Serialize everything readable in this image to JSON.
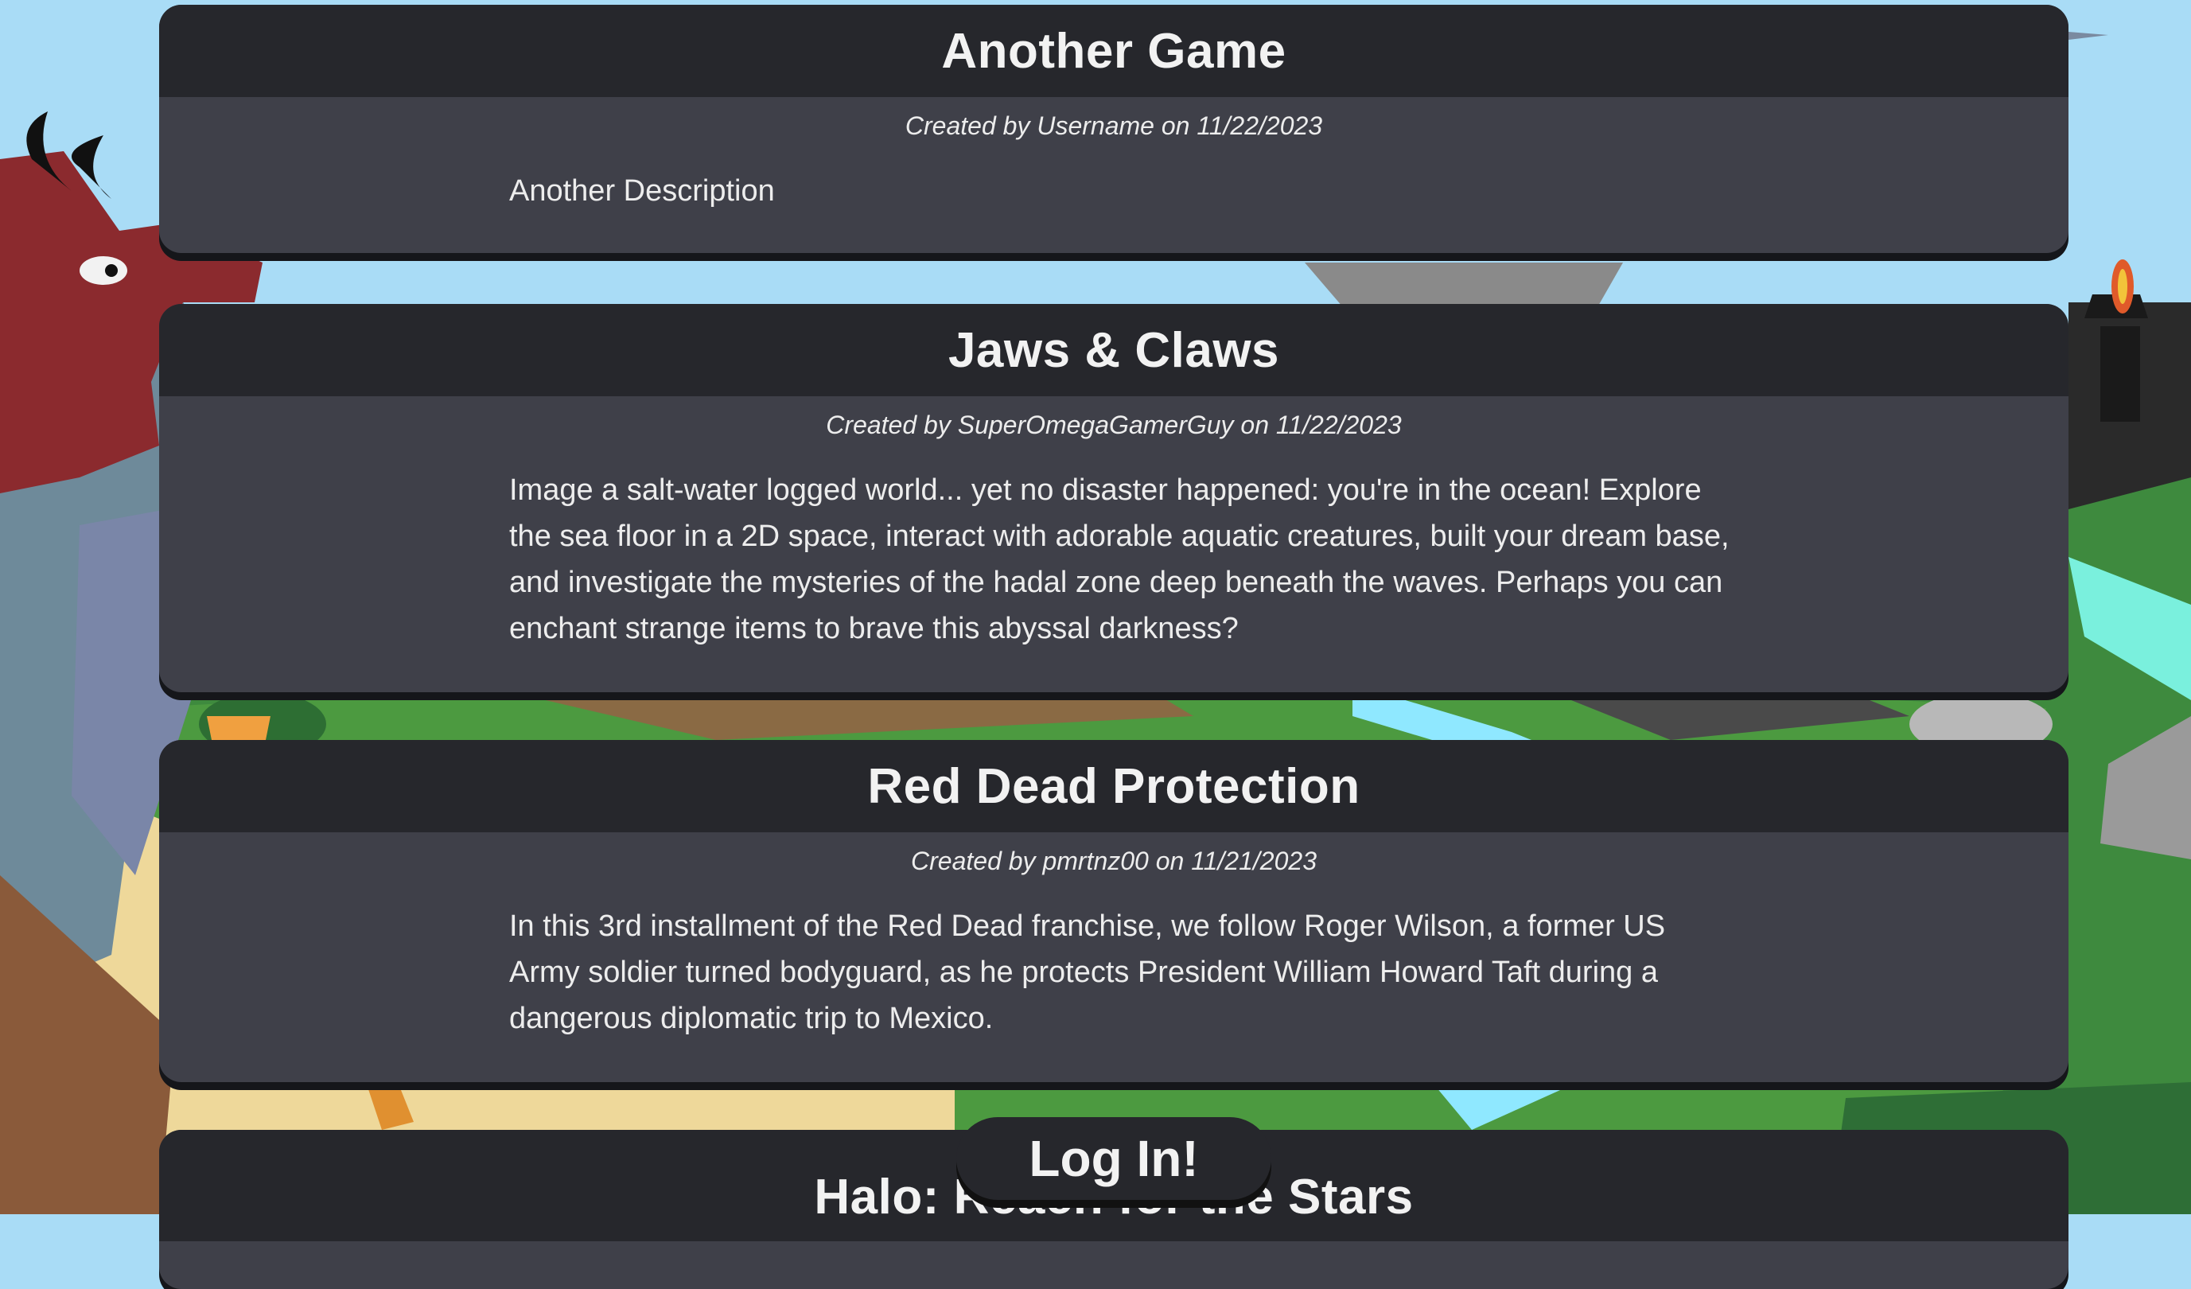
{
  "games": [
    {
      "title": "Another Game",
      "author": "Username",
      "date": "11/22/2023",
      "meta": "Created by Username on 11/22/2023",
      "description": "Another Description"
    },
    {
      "title": "Jaws & Claws",
      "author": "SuperOmegaGamerGuy",
      "date": "11/22/2023",
      "meta": "Created by SuperOmegaGamerGuy on 11/22/2023",
      "description": "Image a salt-water logged world... yet no disaster happened: you're in the ocean! Explore the sea floor in a 2D space, interact with adorable aquatic creatures, built your dream base, and investigate the mysteries of the hadal zone deep beneath the waves. Perhaps you can enchant strange items to brave this abyssal darkness?"
    },
    {
      "title": "Red Dead Protection",
      "author": "pmrtnz00",
      "date": "11/21/2023",
      "meta": "Created by pmrtnz00 on 11/21/2023",
      "description": "In this 3rd installment of the Red Dead franchise, we follow Roger Wilson, a former US Army soldier turned bodyguard, as he protects President William Howard Taft during a dangerous diplomatic trip to Mexico."
    },
    {
      "title": "Halo: Reach for the Stars"
    }
  ],
  "login": {
    "label": "Log In!"
  },
  "colors": {
    "sky": "#a9dcf6",
    "card_body": "#3f4049",
    "card_header": "#26272c",
    "text": "#ededed"
  }
}
